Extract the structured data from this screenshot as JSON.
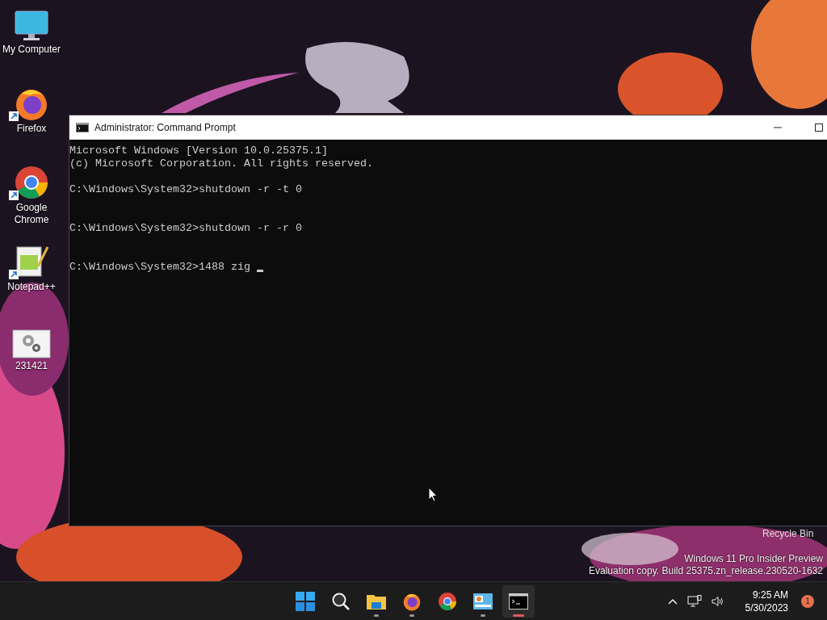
{
  "desktop_icons": [
    {
      "kind": "computer",
      "label": "My Computer",
      "shortcut": false
    },
    {
      "kind": "firefox",
      "label": "Firefox",
      "shortcut": true
    },
    {
      "kind": "chrome",
      "label": "Google Chrome",
      "shortcut": true
    },
    {
      "kind": "notepad",
      "label": "Notepad++",
      "shortcut": true
    },
    {
      "kind": "settings-file",
      "label": "231421",
      "shortcut": false
    }
  ],
  "recycle_bin": {
    "label": "Recycle Bin"
  },
  "window": {
    "title": "Administrator: Command Prompt",
    "console": {
      "header": [
        "Microsoft Windows [Version 10.0.25375.1]",
        "(c) Microsoft Corporation. All rights reserved."
      ],
      "commands": [
        {
          "text": "C:\\Windows\\System32>shutdown -r -t 0",
          "cursor": false
        },
        {
          "text": "C:\\Windows\\System32>shutdown -r -r 0",
          "cursor": false
        },
        {
          "text": "C:\\Windows\\System32>1488 zig ",
          "cursor": true
        }
      ]
    }
  },
  "watermark": [
    "Windows 11 Pro Insider Preview",
    "Evaluation copy. Build 25375.zn_release.230520-1632"
  ],
  "taskbar": {
    "items": [
      {
        "kind": "start",
        "running": false,
        "active": false
      },
      {
        "kind": "search",
        "running": false,
        "active": false
      },
      {
        "kind": "explorer",
        "running": true,
        "active": false
      },
      {
        "kind": "firefox",
        "running": true,
        "active": false
      },
      {
        "kind": "chrome",
        "running": false,
        "active": false
      },
      {
        "kind": "control",
        "running": true,
        "active": false
      },
      {
        "kind": "terminal",
        "running": true,
        "active": true
      }
    ],
    "time": "9:25 AM",
    "date": "5/30/2023",
    "notifications": "1"
  }
}
